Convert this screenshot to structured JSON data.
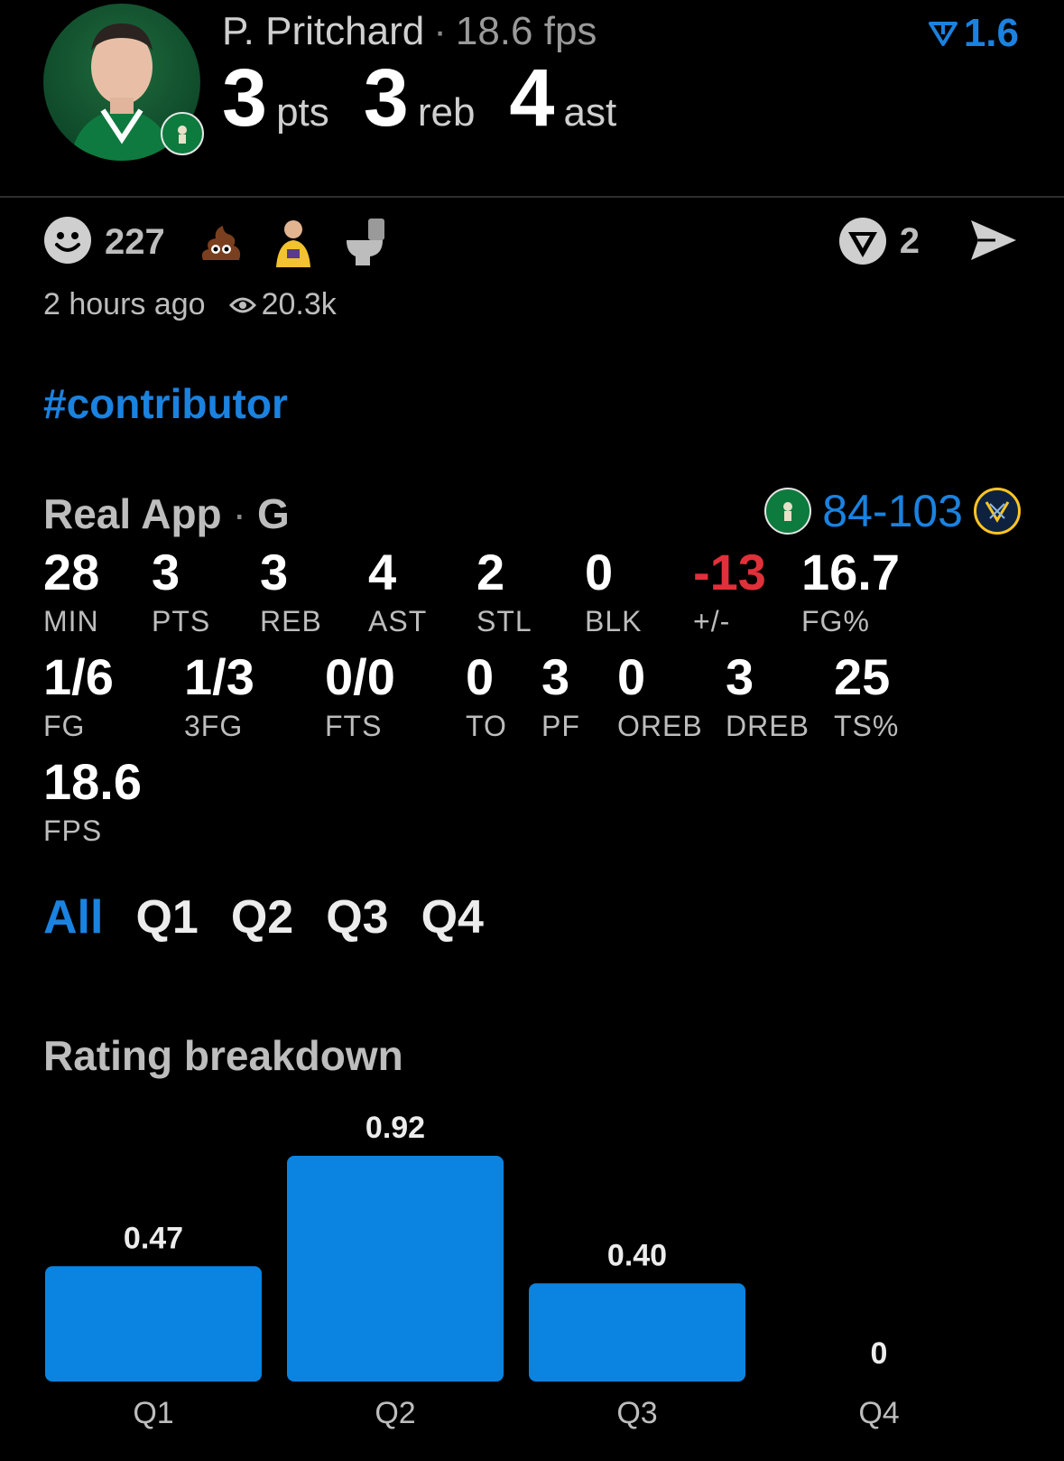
{
  "player": {
    "name": "P. Pritchard",
    "separator": "·",
    "fps_text": "18.6 fps",
    "fps_delta": "1.6",
    "headline": [
      {
        "value": "3",
        "unit": "pts"
      },
      {
        "value": "3",
        "unit": "reb"
      },
      {
        "value": "4",
        "unit": "ast"
      }
    ]
  },
  "reactions": {
    "count": "227",
    "emojis": [
      "smiley-icon",
      "poop-icon",
      "player-icon",
      "toilet-icon"
    ]
  },
  "vote": {
    "count": "2"
  },
  "meta": {
    "time": "2 hours ago",
    "views": "20.3k"
  },
  "hashtag": "#contributor",
  "source": {
    "app": "Real App",
    "separator": "·",
    "position": "G",
    "score": "84-103"
  },
  "stats_row1": [
    {
      "value": "28",
      "label": "MIN"
    },
    {
      "value": "3",
      "label": "PTS"
    },
    {
      "value": "3",
      "label": "REB"
    },
    {
      "value": "4",
      "label": "AST"
    },
    {
      "value": "2",
      "label": "STL"
    },
    {
      "value": "0",
      "label": "BLK"
    },
    {
      "value": "-13",
      "label": "+/-"
    },
    {
      "value": "16.7",
      "label": "FG%"
    }
  ],
  "stats_row2": [
    {
      "value": "1/6",
      "label": "FG"
    },
    {
      "value": "1/3",
      "label": "3FG"
    },
    {
      "value": "0/0",
      "label": "FTS"
    },
    {
      "value": "0",
      "label": "TO"
    },
    {
      "value": "3",
      "label": "PF"
    },
    {
      "value": "0",
      "label": "OREB"
    },
    {
      "value": "3",
      "label": "DREB"
    },
    {
      "value": "25",
      "label": "TS%"
    }
  ],
  "stats_row3": [
    {
      "value": "18.6",
      "label": "FPS"
    }
  ],
  "tabs": [
    "All",
    "Q1",
    "Q2",
    "Q3",
    "Q4"
  ],
  "rating_title": "Rating breakdown",
  "colors": {
    "accent": "#1a82e0",
    "negative": "#e0303a",
    "bar": "#0a84e0"
  },
  "chart_data": {
    "type": "bar",
    "categories": [
      "Q1",
      "Q2",
      "Q3",
      "Q4"
    ],
    "values": [
      0.47,
      0.92,
      0.4,
      0
    ],
    "value_labels": [
      "0.47",
      "0.92",
      "0.40",
      "0"
    ],
    "title": "Rating breakdown",
    "xlabel": "",
    "ylabel": "",
    "ylim": [
      0,
      0.92
    ],
    "grid": false
  }
}
